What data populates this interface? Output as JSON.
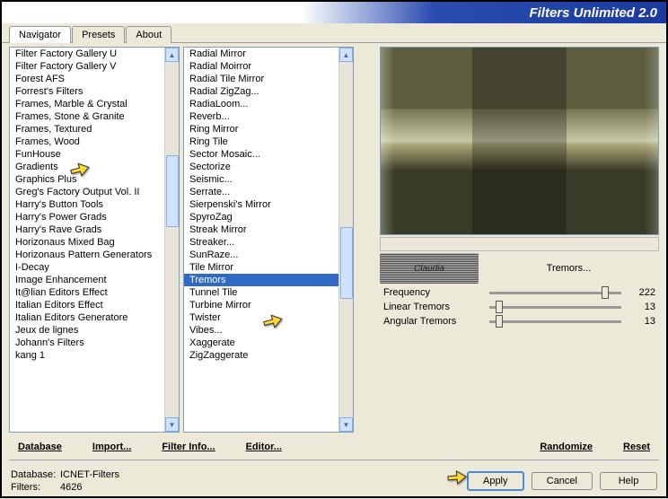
{
  "title": "Filters Unlimited 2.0",
  "tabs": [
    "Navigator",
    "Presets",
    "About"
  ],
  "activeTab": 0,
  "list1": [
    "Filter Factory Gallery U",
    "Filter Factory Gallery V",
    "Forest AFS",
    "Forrest's Filters",
    "Frames, Marble & Crystal",
    "Frames, Stone & Granite",
    "Frames, Textured",
    "Frames, Wood",
    "FunHouse",
    "Gradients",
    "Graphics Plus",
    "Greg's Factory Output Vol. II",
    "Harry's Button Tools",
    "Harry's Power Grads",
    "Harry's Rave Grads",
    "Horizonaus Mixed Bag",
    "Horizonaus Pattern Generators",
    "I-Decay",
    "Image Enhancement",
    "It@lian Editors Effect",
    "Italian Editors Effect",
    "Italian Editors Generatore",
    "Jeux de lignes",
    "Johann's Filters",
    "kang 1"
  ],
  "list2": [
    "Radial Mirror",
    "Radial Moirror",
    "Radial Tile Mirror",
    "Radial ZigZag...",
    "RadiaLoom...",
    "Reverb...",
    "Ring Mirror",
    "Ring Tile",
    "Sector Mosaic...",
    "Sectorize",
    "Seismic...",
    "Serrate...",
    "Sierpenski's Mirror",
    "SpyroZag",
    "Streak Mirror",
    "Streaker...",
    "SunRaze...",
    "Tile Mirror",
    "Tremors",
    "Tunnel Tile",
    "Turbine Mirror",
    "Twister",
    "Vibes...",
    "Xaggerate",
    "ZigZaggerate"
  ],
  "selectedFilter": "Tremors...",
  "selectedIndex2": 18,
  "claudia": "Claudia",
  "params": [
    {
      "label": "Frequency",
      "value": 222,
      "pos": 85
    },
    {
      "label": "Linear Tremors",
      "value": 13,
      "pos": 5
    },
    {
      "label": "Angular Tremors",
      "value": 13,
      "pos": 5
    }
  ],
  "links": {
    "database": "Database",
    "import": "Import...",
    "filterinfo": "Filter Info...",
    "editor": "Editor...",
    "randomize": "Randomize",
    "reset": "Reset"
  },
  "footer": {
    "dbLabel": "Database:",
    "dbValue": "ICNET-Filters",
    "filtersLabel": "Filters:",
    "filtersValue": "4626"
  },
  "buttons": {
    "apply": "Apply",
    "cancel": "Cancel",
    "help": "Help"
  }
}
